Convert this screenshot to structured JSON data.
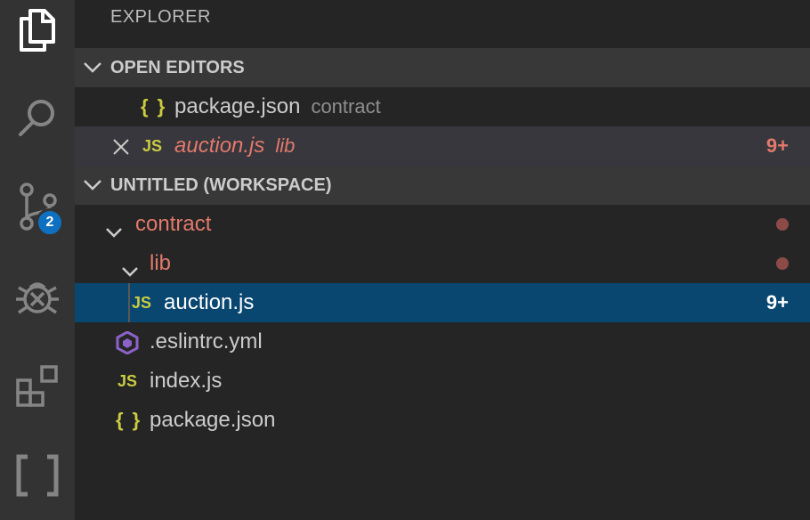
{
  "activity_bar": {
    "items": [
      {
        "name": "explorer",
        "icon": "files-icon"
      },
      {
        "name": "search",
        "icon": "search-icon"
      },
      {
        "name": "source-control",
        "icon": "source-control-icon",
        "badge": "2"
      },
      {
        "name": "debug",
        "icon": "debug-icon"
      },
      {
        "name": "extensions",
        "icon": "extensions-icon"
      },
      {
        "name": "remote",
        "icon": "square-frame-icon"
      }
    ]
  },
  "explorer": {
    "title": "EXPLORER",
    "open_editors": {
      "header": "OPEN EDITORS",
      "items": [
        {
          "icon": "{ }",
          "label": "package.json",
          "description": "contract"
        },
        {
          "icon": "JS",
          "label": "auction.js",
          "description": "lib",
          "count": "9+"
        }
      ]
    },
    "workspace": {
      "header": "UNTITLED (WORKSPACE)",
      "tree": [
        {
          "label": "contract"
        },
        {
          "label": "lib"
        },
        {
          "icon": "JS",
          "label": "auction.js",
          "count": "9+"
        },
        {
          "label": ".eslintrc.yml"
        },
        {
          "icon": "JS",
          "label": "index.js"
        },
        {
          "icon": "{ }",
          "label": "package.json"
        }
      ]
    }
  },
  "colors": {
    "modified": "#e2796b",
    "js_icon": "#cbcb41",
    "selection": "#094771",
    "badge": "#0e70c0"
  }
}
